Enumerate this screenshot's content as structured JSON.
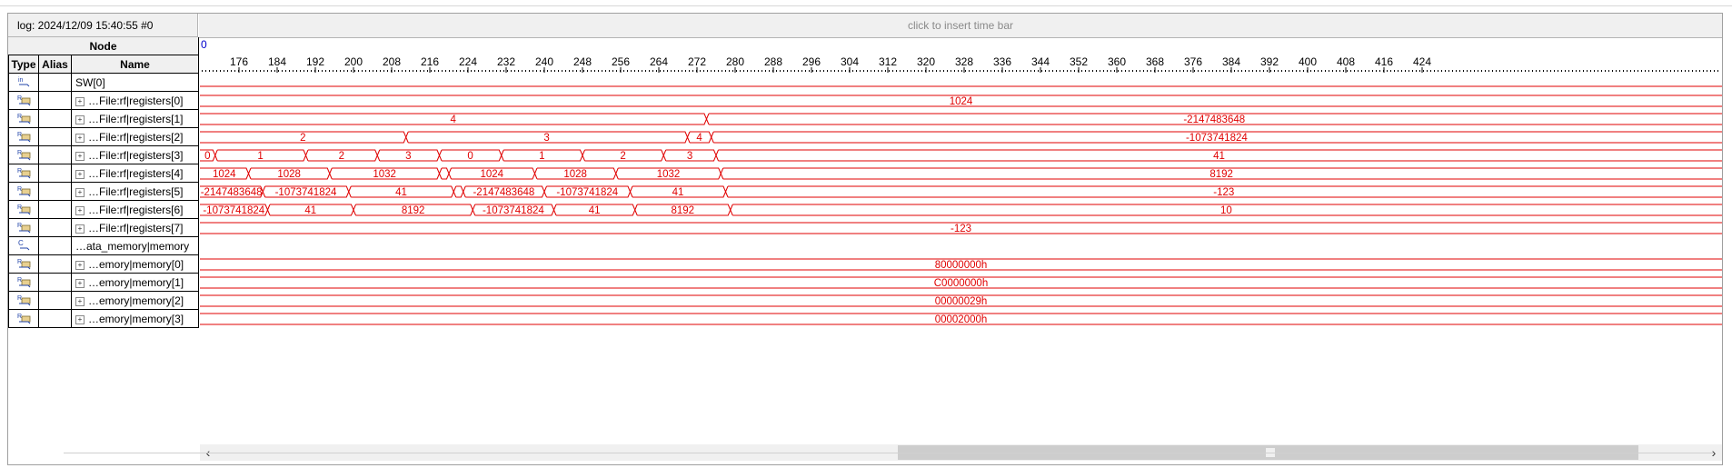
{
  "log_label": "log: 2024/12/09 15:40:55  #0",
  "timebar_hint": "click to insert time bar",
  "header": {
    "node": "Node",
    "type": "Type",
    "alias": "Alias",
    "name": "Name"
  },
  "cursor_value": "0",
  "scale": {
    "start": 168,
    "step": 8,
    "ticks": [
      "176",
      "184",
      "192",
      "200",
      "208",
      "216",
      "224",
      "232",
      "240",
      "248",
      "256",
      "264",
      "272",
      "280",
      "288",
      "296",
      "304",
      "312",
      "320",
      "328",
      "336",
      "344",
      "352",
      "360",
      "368",
      "376",
      "384",
      "392",
      "400",
      "408",
      "416",
      "424"
    ]
  },
  "rows": [
    {
      "type": "in",
      "expandable": false,
      "name": "SW[0]",
      "segments": [
        {
          "to": 424,
          "label": ""
        }
      ]
    },
    {
      "type": "bus",
      "expandable": true,
      "name": "…File:rf|registers[0]",
      "segments": [
        {
          "to": 424,
          "label": "1024"
        }
      ]
    },
    {
      "type": "bus",
      "expandable": true,
      "name": "…File:rf|registers[1]",
      "segments": [
        {
          "to": 274,
          "label": "4"
        },
        {
          "to": 424,
          "label": "-2147483648"
        }
      ]
    },
    {
      "type": "bus",
      "expandable": true,
      "name": "…File:rf|registers[2]",
      "segments": [
        {
          "to": 211,
          "label": "2"
        },
        {
          "to": 270,
          "label": "3"
        },
        {
          "to": 275,
          "label": "4"
        },
        {
          "to": 424,
          "label": "-1073741824"
        }
      ]
    },
    {
      "type": "bus",
      "expandable": true,
      "name": "…File:rf|registers[3]",
      "segments": [
        {
          "to": 171,
          "label": "0"
        },
        {
          "to": 190,
          "label": "1"
        },
        {
          "to": 205,
          "label": "2"
        },
        {
          "to": 218,
          "label": "3"
        },
        {
          "to": 231,
          "label": "0"
        },
        {
          "to": 248,
          "label": "1"
        },
        {
          "to": 265,
          "label": "2"
        },
        {
          "to": 276,
          "label": "3"
        },
        {
          "to": 424,
          "label": "41"
        }
      ]
    },
    {
      "type": "bus",
      "expandable": true,
      "name": "…File:rf|registers[4]",
      "segments": [
        {
          "to": 178,
          "label": "1024"
        },
        {
          "to": 195,
          "label": "1028"
        },
        {
          "to": 218,
          "label": "1032"
        },
        {
          "to": 220,
          "label": ""
        },
        {
          "to": 238,
          "label": "1024"
        },
        {
          "to": 255,
          "label": "1028"
        },
        {
          "to": 277,
          "label": "1032"
        },
        {
          "to": 424,
          "label": "8192"
        }
      ]
    },
    {
      "type": "bus",
      "expandable": true,
      "name": "…File:rf|registers[5]",
      "segments": [
        {
          "to": 181,
          "label": "-2147483648"
        },
        {
          "to": 199,
          "label": "-1073741824"
        },
        {
          "to": 221,
          "label": "41"
        },
        {
          "to": 223,
          "label": ""
        },
        {
          "to": 240,
          "label": "-2147483648"
        },
        {
          "to": 258,
          "label": "-1073741824"
        },
        {
          "to": 278,
          "label": "41"
        },
        {
          "to": 424,
          "label": "-123"
        }
      ]
    },
    {
      "type": "bus",
      "expandable": true,
      "name": "…File:rf|registers[6]",
      "segments": [
        {
          "to": 182,
          "label": "-1073741824"
        },
        {
          "to": 200,
          "label": "41"
        },
        {
          "to": 225,
          "label": "8192"
        },
        {
          "to": 242,
          "label": "-1073741824"
        },
        {
          "to": 259,
          "label": "41"
        },
        {
          "to": 279,
          "label": "8192"
        },
        {
          "to": 424,
          "label": "10"
        }
      ]
    },
    {
      "type": "bus",
      "expandable": true,
      "name": "…File:rf|registers[7]",
      "segments": [
        {
          "to": 424,
          "label": "-123"
        }
      ]
    },
    {
      "type": "mem",
      "expandable": false,
      "name": "…ata_memory|memory",
      "segments": []
    },
    {
      "type": "bus",
      "expandable": true,
      "name": "…emory|memory[0]",
      "segments": [
        {
          "to": 424,
          "label": "80000000h"
        }
      ]
    },
    {
      "type": "bus",
      "expandable": true,
      "name": "…emory|memory[1]",
      "segments": [
        {
          "to": 424,
          "label": "C0000000h"
        }
      ]
    },
    {
      "type": "bus",
      "expandable": true,
      "name": "…emory|memory[2]",
      "segments": [
        {
          "to": 424,
          "label": "00000029h"
        }
      ]
    },
    {
      "type": "bus",
      "expandable": true,
      "name": "…emory|memory[3]",
      "segments": [
        {
          "to": 424,
          "label": "00002000h"
        }
      ]
    }
  ],
  "scrollbar": {
    "left_arrow": "‹",
    "right_arrow": "›",
    "thumb_start_fraction": 0.46,
    "thumb_width_fraction": 0.49
  },
  "colors": {
    "wave": "#e00000",
    "cursor": "#0000cc",
    "panel_bg": "#f0f0f0"
  }
}
